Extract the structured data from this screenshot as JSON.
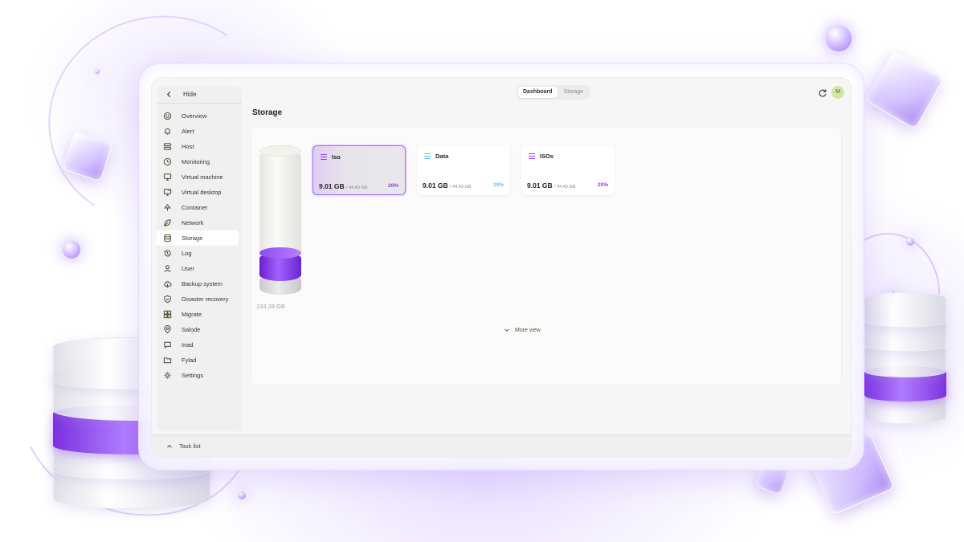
{
  "sidebar": {
    "hide_label": "Hide",
    "items": [
      {
        "label": "Overview",
        "icon": "smile-icon"
      },
      {
        "label": "Alert",
        "icon": "bell-icon"
      },
      {
        "label": "Host",
        "icon": "server-icon"
      },
      {
        "label": "Monitoring",
        "icon": "clock-icon"
      },
      {
        "label": "Virtual machine",
        "icon": "monitor-icon"
      },
      {
        "label": "Virtual desktop",
        "icon": "desktop-icon"
      },
      {
        "label": "Container",
        "icon": "tree-icon"
      },
      {
        "label": "Network",
        "icon": "leaf-icon"
      },
      {
        "label": "Storage",
        "icon": "database-icon"
      },
      {
        "label": "Log",
        "icon": "history-icon"
      },
      {
        "label": "User",
        "icon": "user-icon"
      },
      {
        "label": "Backup system",
        "icon": "cloud-icon"
      },
      {
        "label": "Disaster recovery",
        "icon": "shield-icon"
      },
      {
        "label": "Migrate",
        "icon": "grid-icon"
      },
      {
        "label": "Salode",
        "icon": "pin-icon"
      },
      {
        "label": "Inad",
        "icon": "chat-icon"
      },
      {
        "label": "Fylad",
        "icon": "folder-icon"
      },
      {
        "label": "Settings",
        "icon": "gear-icon"
      }
    ],
    "active": "Storage"
  },
  "header": {
    "tabs": [
      "Dashboard",
      "Storage"
    ],
    "active_tab": "Dashboard",
    "avatar_initial": "M"
  },
  "page": {
    "title": "Storage"
  },
  "storage": {
    "total_label": "133.28 GB",
    "purple_fraction": 0.2,
    "grey_fraction": 0.14,
    "cards": [
      {
        "name": "Iso",
        "used": "9.01 GB",
        "total": "/ 44.43 GB",
        "percent": "20%",
        "accent": "#8a3ee6",
        "selected": true
      },
      {
        "name": "Data",
        "used": "9.01 GB",
        "total": "/ 44.43 GB",
        "percent": "20%",
        "accent": "#5bc3e8",
        "selected": false
      },
      {
        "name": "ISOs",
        "used": "9.01 GB",
        "total": "/ 44.43 GB",
        "percent": "20%",
        "accent": "#8a3ee6",
        "selected": false
      }
    ],
    "more_view_label": "More view"
  },
  "footer": {
    "task_list_label": "Task list"
  },
  "colors": {
    "brand_purple": "#8a3ee6",
    "accent_olive": "#555a40",
    "avatar_bg": "#d3e6a3"
  }
}
